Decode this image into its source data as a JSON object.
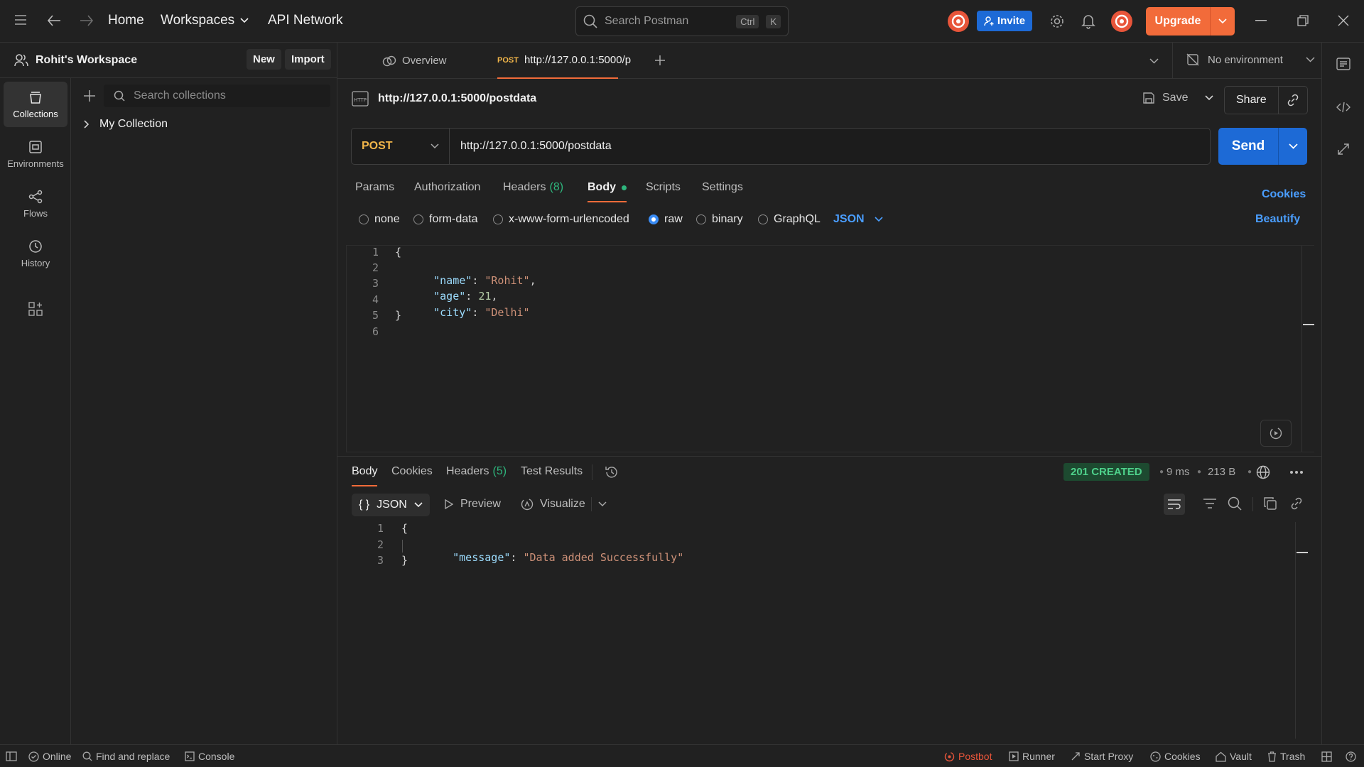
{
  "topbar": {
    "nav": {
      "home": "Home",
      "workspaces": "Workspaces",
      "api_network": "API Network"
    },
    "search": {
      "placeholder": "Search Postman",
      "shortcut_ctrl": "Ctrl",
      "shortcut_key": "K"
    },
    "invite_label": "Invite",
    "upgrade_label": "Upgrade"
  },
  "workspace": {
    "name": "Rohit's Workspace",
    "new_label": "New",
    "import_label": "Import"
  },
  "rail": {
    "items": [
      {
        "label": "Collections",
        "icon": "collections-icon"
      },
      {
        "label": "Environments",
        "icon": "environments-icon"
      },
      {
        "label": "Flows",
        "icon": "flows-icon"
      },
      {
        "label": "History",
        "icon": "history-icon"
      }
    ]
  },
  "sidebar": {
    "search_placeholder": "Search collections",
    "collections": [
      {
        "name": "My Collection"
      }
    ]
  },
  "tabs": {
    "overview": "Overview",
    "active": {
      "method": "POST",
      "title": "http://127.0.0.1:5000/p"
    },
    "environment": "No environment"
  },
  "request": {
    "title": "http://127.0.0.1:5000/postdata",
    "save_label": "Save",
    "share_label": "Share",
    "method": "POST",
    "url": "http://127.0.0.1:5000/postdata",
    "send_label": "Send",
    "tabs": {
      "params": "Params",
      "authorization": "Authorization",
      "headers": "Headers",
      "headers_count": "(8)",
      "body": "Body",
      "scripts": "Scripts",
      "settings": "Settings"
    },
    "cookies_label": "Cookies",
    "beautify_label": "Beautify",
    "body_types": {
      "none": "none",
      "form_data": "form-data",
      "urlencoded": "x-www-form-urlencoded",
      "raw": "raw",
      "binary": "binary",
      "graphql": "GraphQL"
    },
    "body_format": "JSON",
    "body_lines": {
      "n1": "1",
      "n2": "2",
      "n3": "3",
      "n4": "4",
      "n5": "5",
      "n6": "6",
      "open": "{",
      "name_key": "\"name\"",
      "name_val": "\"Rohit\"",
      "age_key": "\"age\"",
      "age_val": "21",
      "city_key": "\"city\"",
      "city_val": "\"Delhi\"",
      "close": "}"
    }
  },
  "response": {
    "tabs": {
      "body": "Body",
      "cookies": "Cookies",
      "headers": "Headers",
      "headers_count": "(5)",
      "test_results": "Test Results"
    },
    "status": "201 CREATED",
    "time": "9 ms",
    "size": "213 B",
    "format": "JSON",
    "preview_label": "Preview",
    "visualize_label": "Visualize",
    "body_lines": {
      "n1": "1",
      "n2": "2",
      "n3": "3",
      "open": "{",
      "msg_key": "\"message\"",
      "msg_val": "\"Data added Successfully\"",
      "close": "}"
    }
  },
  "statusbar": {
    "online": "Online",
    "find_replace": "Find and replace",
    "console": "Console",
    "postbot": "Postbot",
    "runner": "Runner",
    "start_proxy": "Start Proxy",
    "cookies": "Cookies",
    "vault": "Vault",
    "trash": "Trash"
  },
  "colors": {
    "accent_orange": "#f26b3a",
    "accent_blue": "#1d6ad6",
    "status_green": "#2eb67d",
    "method_post": "#f2b64a"
  }
}
